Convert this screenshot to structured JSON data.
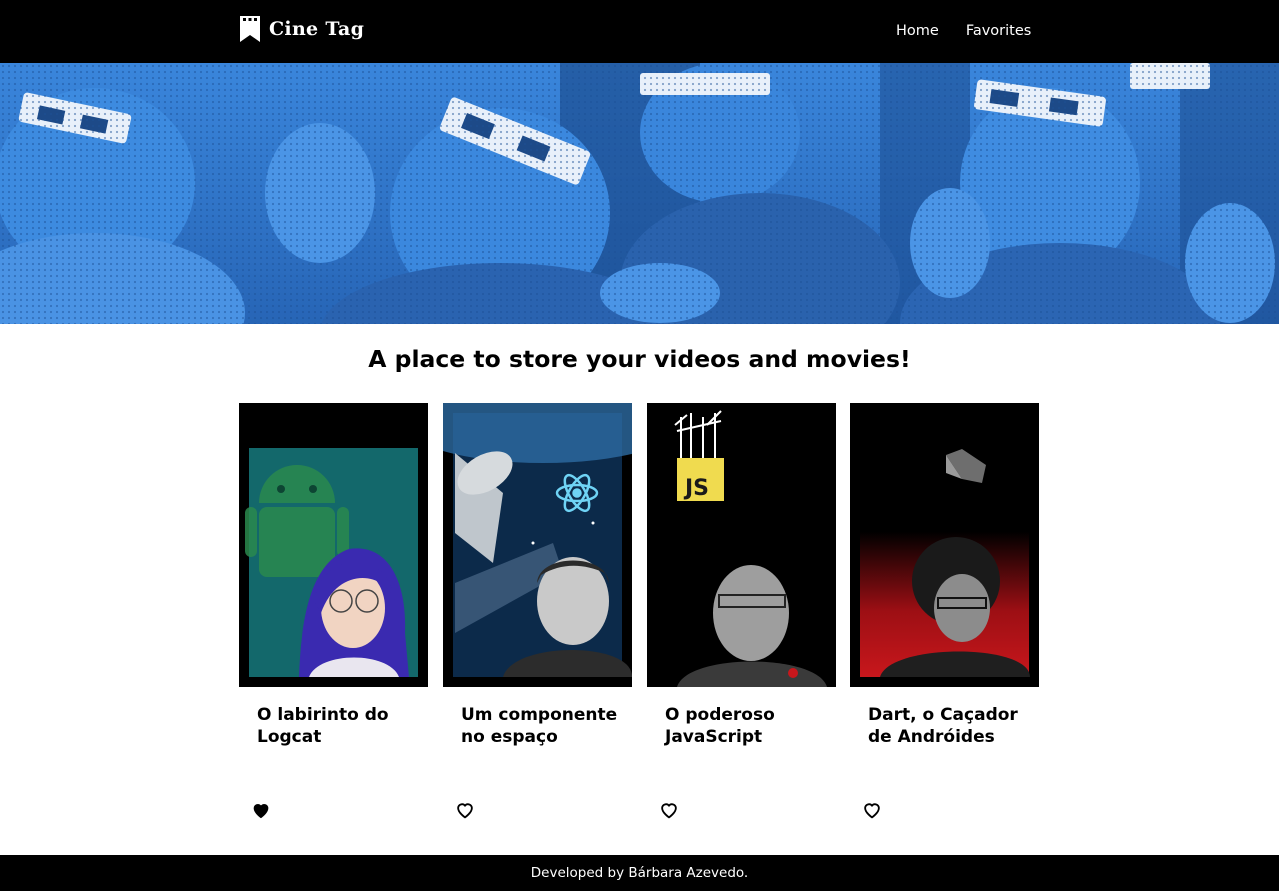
{
  "header": {
    "logo_text": "Cine Tag",
    "nav": [
      {
        "label": "Home"
      },
      {
        "label": "Favorites"
      }
    ]
  },
  "headline": "A place to store your videos and movies!",
  "videos": [
    {
      "title": "O labirinto do Logcat",
      "favorite": true,
      "icon": "android-icon",
      "accent": "#1fa5a0"
    },
    {
      "title": "Um componente no espaço",
      "favorite": false,
      "icon": "react-icon",
      "accent": "#2e8fc4"
    },
    {
      "title": "O poderoso JavaScript",
      "favorite": false,
      "icon": "javascript-icon",
      "accent": "#f0db4f"
    },
    {
      "title": "Dart, o Caçador de Andróides",
      "favorite": false,
      "icon": "dart-icon",
      "accent": "#c8171c"
    }
  ],
  "footer": {
    "text": "Developed by Bárbara Azevedo."
  },
  "colors": {
    "header_bg": "#000000",
    "hero_blue": "#2f78cf",
    "footer_bg": "#000000"
  }
}
